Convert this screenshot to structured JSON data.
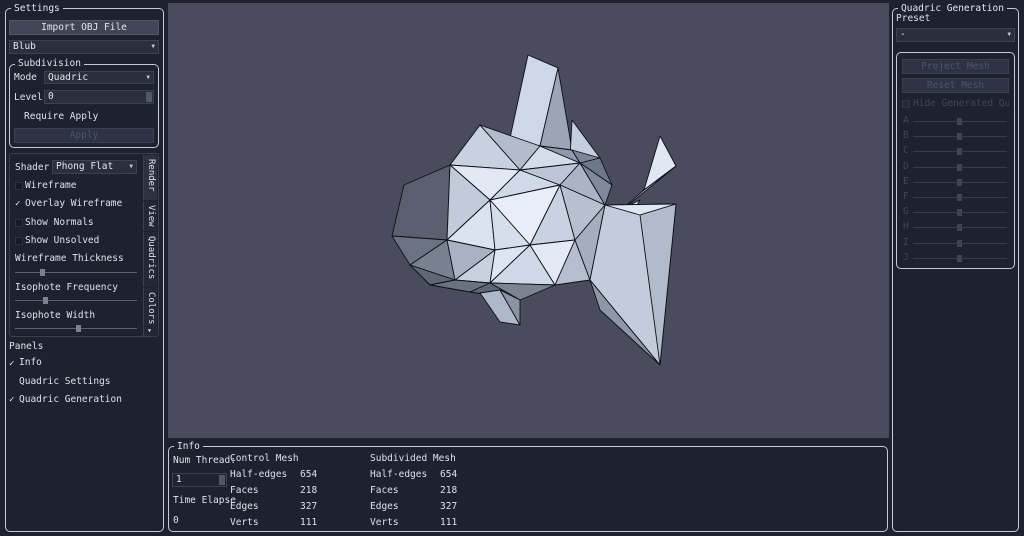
{
  "settings": {
    "title": "Settings",
    "import_button": "Import OBJ File",
    "model_select": "Blub",
    "subdivision": {
      "title": "Subdivision",
      "mode_label": "Mode",
      "mode_value": "Quadric",
      "level_label": "Level",
      "level_value": "0",
      "require_apply": "Require Apply",
      "apply_button": "Apply"
    },
    "render": {
      "shader_label": "Shader",
      "shader_value": "Phong Flat",
      "wireframe": "Wireframe",
      "overlay_wireframe": "Overlay Wireframe",
      "show_normals": "Show Normals",
      "show_unsolved": "Show Unsolved",
      "wireframe_thickness": "Wireframe Thickness",
      "isophote_frequency": "Isophote Frequency",
      "isophote_width": "Isophote Width",
      "wireframe_thickness_level": 0.25,
      "isophote_frequency_level": 0.25,
      "isophote_width_level": 0.5
    },
    "tabs": [
      "Render",
      "View",
      "Quadrics",
      "Colors"
    ],
    "panels": {
      "title": "Panels",
      "info": "Info",
      "quadric_settings": "Quadric Settings",
      "quadric_generation": "Quadric Generation"
    }
  },
  "info": {
    "title": "Info",
    "num_threads_label": "Num Thread:",
    "num_threads_value": "1",
    "time_elapsed_label": "Time Elapse",
    "time_elapsed_value": "0",
    "control_mesh": {
      "title": "Control Mesh",
      "rows": [
        {
          "label": "Half-edges",
          "value": "654"
        },
        {
          "label": "Faces",
          "value": "218"
        },
        {
          "label": "Edges",
          "value": "327"
        },
        {
          "label": "Verts",
          "value": "111"
        }
      ]
    },
    "subdivided_mesh": {
      "title": "Subdivided Mesh",
      "rows": [
        {
          "label": "Half-edges",
          "value": "654"
        },
        {
          "label": "Faces",
          "value": "218"
        },
        {
          "label": "Edges",
          "value": "327"
        },
        {
          "label": "Verts",
          "value": "111"
        }
      ]
    }
  },
  "quadric_generation": {
    "title": "Quadric Generation",
    "preset_label": "Preset",
    "preset_value": "-",
    "project_mesh": "Project Mesh",
    "reset_mesh": "Reset Mesh",
    "hide_generated": "Hide Generated Quad",
    "sliders": [
      "A",
      "B",
      "C",
      "D",
      "E",
      "F",
      "G",
      "H",
      "I",
      "J"
    ]
  },
  "colors": {
    "background": "#1d2130",
    "viewport": "#4a4b5d",
    "mesh_light": "#dfe7f3",
    "mesh_dark": "#566070"
  }
}
